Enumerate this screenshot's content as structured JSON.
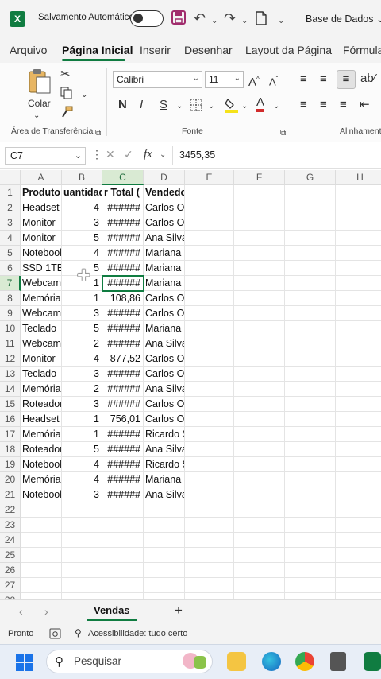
{
  "titlebar": {
    "app_logo": "X",
    "autosave_label": "Salvamento Automático",
    "title": "Base de Dados"
  },
  "tabs": [
    "Arquivo",
    "Página Inicial",
    "Inserir",
    "Desenhar",
    "Layout da Página",
    "Fórmula"
  ],
  "ribbon": {
    "paste_label": "Colar",
    "clipboard_group": "Área de Transferência",
    "font_name": "Calibri",
    "font_size": "11",
    "bold": "N",
    "italic": "I",
    "underline": "S",
    "font_group": "Fonte",
    "alignment_group": "Alinhamento"
  },
  "formula_bar": {
    "name_box": "C7",
    "fx": "fx",
    "value": "3455,35"
  },
  "grid": {
    "columns": [
      "A",
      "B",
      "C",
      "D",
      "E",
      "F",
      "G",
      "H"
    ],
    "rows": [
      "1",
      "2",
      "3",
      "4",
      "5",
      "6",
      "7",
      "8",
      "9",
      "10",
      "11",
      "12",
      "13",
      "14",
      "15",
      "16",
      "17",
      "18",
      "19",
      "20",
      "21",
      "22",
      "23",
      "24",
      "25",
      "26",
      "27",
      "28"
    ],
    "header": [
      "Produto",
      "uantidad",
      "r Total (",
      "Vendedor"
    ],
    "data": [
      [
        "Headset",
        "4",
        "######",
        "Carlos Oliveira"
      ],
      [
        "Monitor",
        "3",
        "######",
        "Carlos Oliveira"
      ],
      [
        "Monitor",
        "5",
        "######",
        "Ana Silva"
      ],
      [
        "Notebook",
        "4",
        "######",
        "Mariana Costa"
      ],
      [
        "SSD 1TB",
        "5",
        "######",
        "Mariana Costa"
      ],
      [
        "Webcam",
        "1",
        "######",
        "Mariana Costa"
      ],
      [
        "Memória",
        "1",
        "108,86",
        "Carlos Oliveira"
      ],
      [
        "Webcam",
        "3",
        "######",
        "Carlos Oliveira"
      ],
      [
        "Teclado",
        "5",
        "######",
        "Mariana Costa"
      ],
      [
        "Webcam",
        "2",
        "######",
        "Ana Silva"
      ],
      [
        "Monitor",
        "4",
        "877,52",
        "Carlos Oliveira"
      ],
      [
        "Teclado",
        "3",
        "######",
        "Carlos Oliveira"
      ],
      [
        "Memória",
        "2",
        "######",
        "Ana Silva"
      ],
      [
        "Roteador",
        "3",
        "######",
        "Carlos Oliveira"
      ],
      [
        "Headset",
        "1",
        "756,01",
        "Carlos Oliveira"
      ],
      [
        "Memória",
        "1",
        "######",
        "Ricardo Santos"
      ],
      [
        "Roteador",
        "5",
        "######",
        "Ana Silva"
      ],
      [
        "Notebook",
        "4",
        "######",
        "Ricardo Santos"
      ],
      [
        "Memória",
        "4",
        "######",
        "Mariana Costa"
      ],
      [
        "Notebook",
        "3",
        "######",
        "Ana Silva"
      ]
    ],
    "selected_cell": "C7"
  },
  "sheet_tabs": {
    "active": "Vendas",
    "add": "+"
  },
  "statusbar": {
    "ready": "Pronto",
    "accessibility": "Acessibilidade: tudo certo"
  },
  "taskbar": {
    "search_placeholder": "Pesquisar"
  },
  "colors": {
    "excel_green": "#107c41",
    "chrome_bg": "#f3f3f3"
  }
}
